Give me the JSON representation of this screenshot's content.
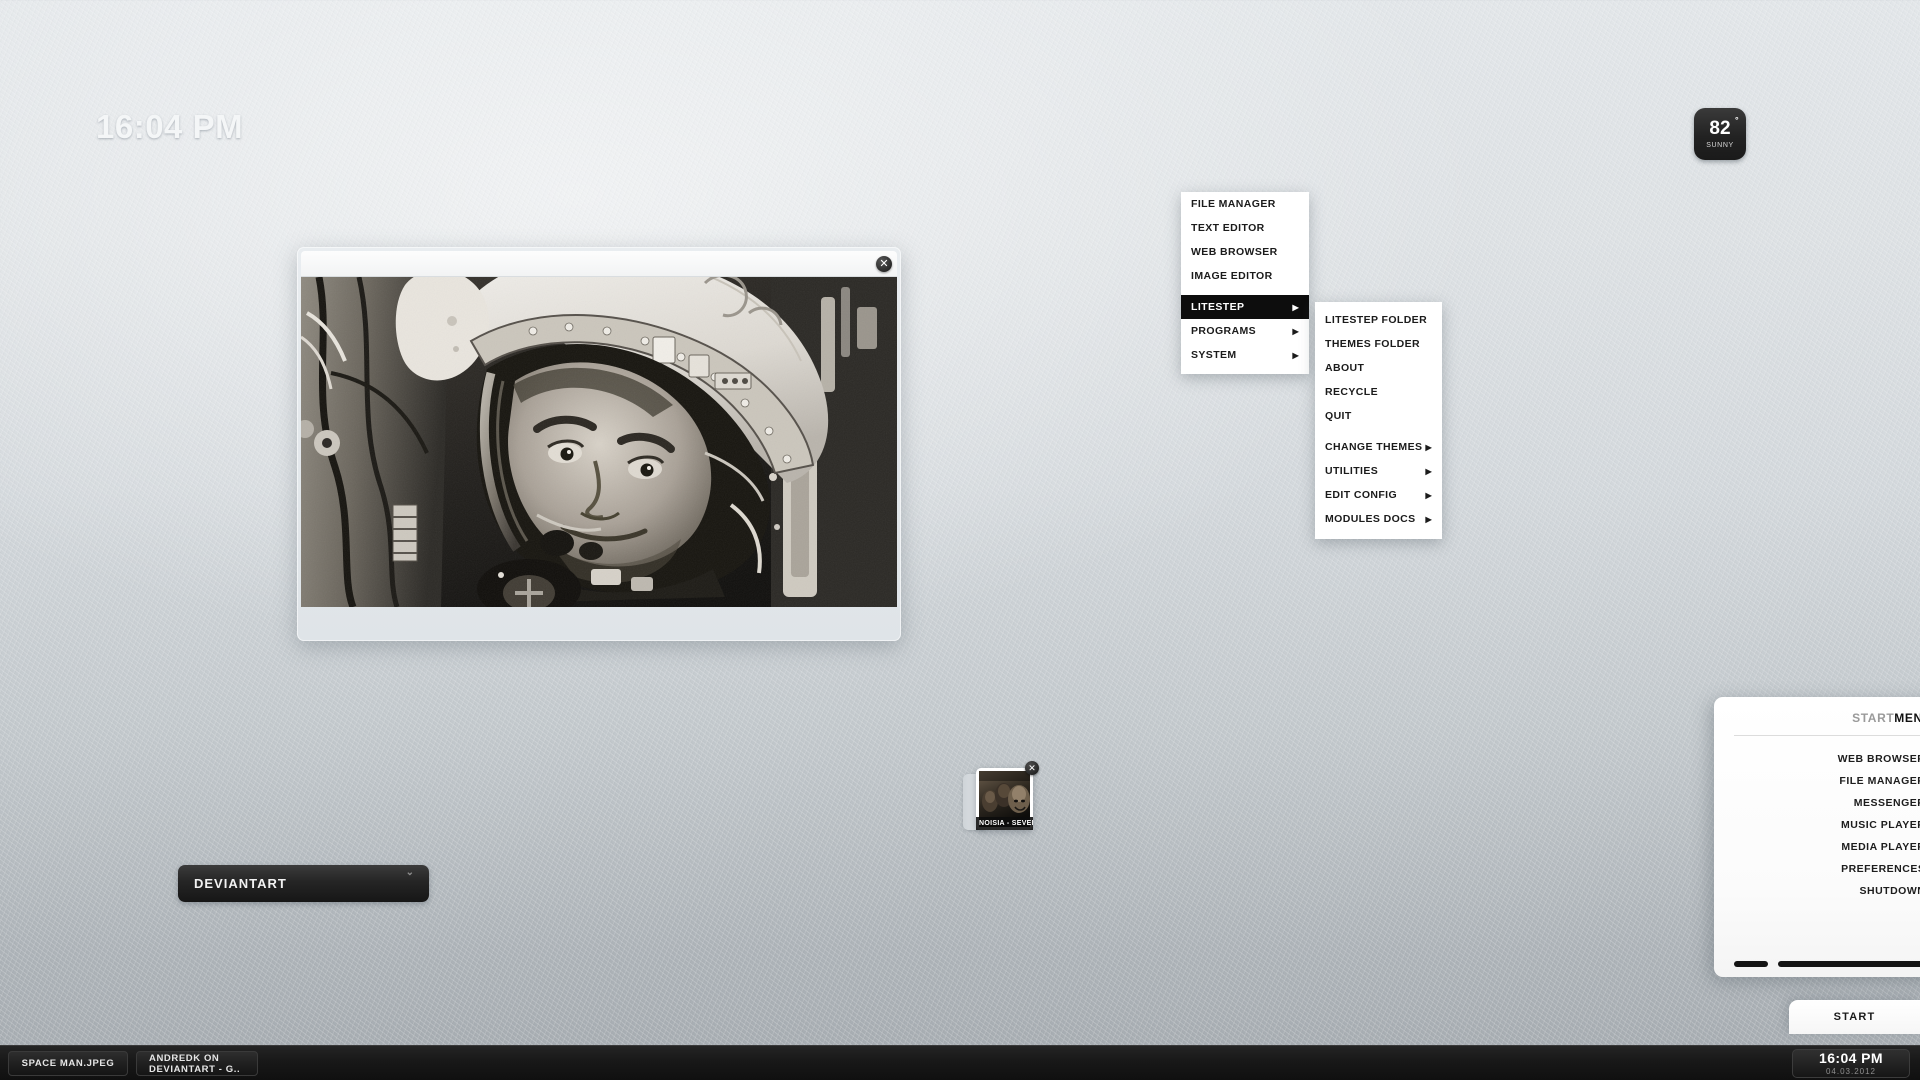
{
  "desktop": {
    "clock": "16:04 PM",
    "weather": {
      "temp": "82",
      "degree": "°",
      "condition": "SUNNY"
    }
  },
  "image_viewer": {
    "title": "",
    "close_icon": "close-icon",
    "photo_alt": "space man.jpeg"
  },
  "context_menu": {
    "items": [
      {
        "label": "FILE MANAGER",
        "arrow": "",
        "active": false
      },
      {
        "label": "TEXT EDITOR",
        "arrow": "",
        "active": false
      },
      {
        "label": "WEB BROWSER",
        "arrow": "",
        "active": false
      },
      {
        "label": "IMAGE EDITOR",
        "arrow": "",
        "active": false
      },
      {
        "label": "LITESTEP",
        "arrow": "▶",
        "active": true
      },
      {
        "label": "PROGRAMS",
        "arrow": "▶",
        "active": false
      },
      {
        "label": "SYSTEM",
        "arrow": "▶",
        "active": false
      }
    ]
  },
  "submenu": {
    "items": [
      {
        "label": "LITESTEP FOLDER",
        "arrow": ""
      },
      {
        "label": "THEMES FOLDER",
        "arrow": ""
      },
      {
        "label": "ABOUT",
        "arrow": ""
      },
      {
        "label": "RECYCLE",
        "arrow": ""
      },
      {
        "label": "QUIT",
        "arrow": ""
      },
      {
        "label": "CHANGE THEMES",
        "arrow": "▶"
      },
      {
        "label": "UTILITIES",
        "arrow": "▶"
      },
      {
        "label": "EDIT CONFIG",
        "arrow": "▶"
      },
      {
        "label": "MODULES DOCS",
        "arrow": "▶"
      }
    ]
  },
  "music_widget": {
    "track": "NOISIA - SEVEN ST",
    "close_icon": "close-icon"
  },
  "deviantart_bar": {
    "label": "DEVIANTART",
    "chevron": "⌄"
  },
  "start_menu": {
    "title_light": "START",
    "title_bold": "MENU",
    "items": [
      {
        "label": "WEB BROWSER",
        "bullet": "•"
      },
      {
        "label": "FILE MANAGER",
        "bullet": "•"
      },
      {
        "label": "MESSENGER",
        "bullet": "•"
      },
      {
        "label": "MUSIC PLAYER",
        "bullet": "•"
      },
      {
        "label": "MEDIA PLAYER",
        "bullet": "•"
      },
      {
        "label": "PREFERENCES",
        "bullet": "•"
      },
      {
        "label": "SHUTDOWN",
        "bullet": "•"
      }
    ]
  },
  "start_button": {
    "label": "START"
  },
  "taskbar": {
    "buttons": [
      {
        "label": "SPACE MAN.JPEG"
      },
      {
        "label": "ANDREDK ON DEVIANTART - G.."
      }
    ],
    "clock": {
      "time": "16:04 PM",
      "date": "04.03.2012"
    }
  },
  "colors": {
    "accent_dark": "#0d0d0d",
    "panel_white": "#ffffff",
    "taskbar": "#181818",
    "desktop_top": "#e2e6e9",
    "desktop_bottom": "#a5abb0"
  }
}
